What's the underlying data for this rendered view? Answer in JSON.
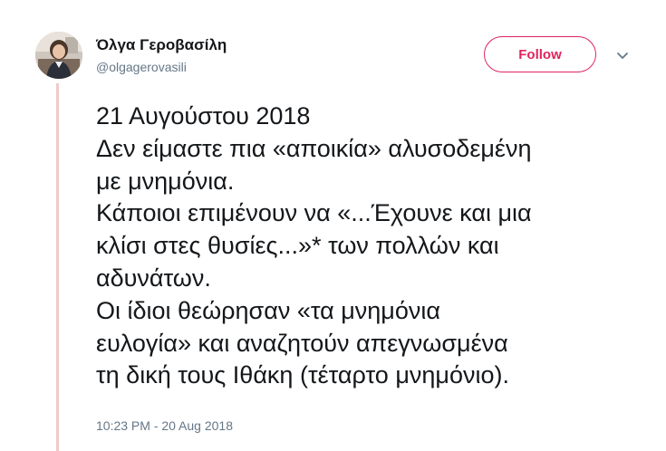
{
  "author": {
    "name": "Όλγα Γεροβασίλη",
    "handle": "@olgagerovasili"
  },
  "follow_label": "Follow",
  "menu_icon": "chevron-down-icon",
  "tweet_lines": [
    "21 Αυγούστου 2018",
    "Δεν είμαστε πια «αποικία» αλυσοδεμένη",
    "με μνημόνια.",
    "Κάποιοι επιμένουν να «...Έχουνε και μια",
    "κλίσι στες θυσίες...»* των πολλών και",
    "αδυνάτων.",
    "Οι ίδιοι θεώρησαν «τα μνημόνια",
    "ευλογία» και αναζητούν απεγνωσμένα",
    "τη δική τους Ιθάκη (τέταρτο μνημόνιο)."
  ],
  "timestamp": "10:23 PM - 20 Aug 2018",
  "colors": {
    "accent": "#e0245e",
    "thread_line": "#f0c9c9",
    "secondary_text": "#657786",
    "primary_text": "#14171a"
  }
}
